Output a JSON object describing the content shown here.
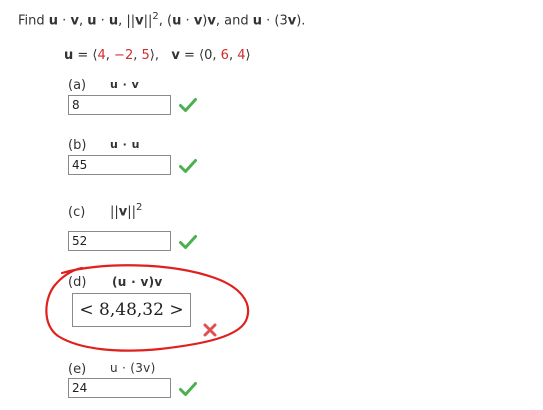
{
  "prompt": {
    "find": "Find",
    "u1": "u",
    "dot1": " · ",
    "v1": "v",
    "sep1": ",  ",
    "u2": "u",
    "dot2": " · ",
    "u3": "u",
    "sep2": ",  ",
    "norm_open": "||",
    "norm_v": "v",
    "norm_close": "||",
    "sq": "2",
    "sep3": ",  (",
    "uv_u": "u",
    "uv_dot": " · ",
    "uv_v": "v",
    "uv_close": ")",
    "uv_vec": "v",
    "sep4": ", and ",
    "u4": "u",
    "dot4": " · (3",
    "v4": "v",
    "end": ")."
  },
  "given": {
    "u_label": "u",
    "u_eq": " = ⟨",
    "u_a": "4",
    "u_c1": ", ",
    "u_b": "−2",
    "u_c2": ", ",
    "u_c": "5",
    "u_close": "⟩,",
    "v_label": "v",
    "v_eq": " = ⟨",
    "v_a": "0",
    "v_c1": ", ",
    "v_b": "6",
    "v_c2": ", ",
    "v_c": "4",
    "v_close": "⟩"
  },
  "parts": [
    {
      "letter": "(a)",
      "expr": "u · v",
      "value": "8",
      "status": "correct"
    },
    {
      "letter": "(b)",
      "expr": "u · u",
      "value": "45",
      "status": "correct"
    },
    {
      "letter": "(c)",
      "expr_open": "||",
      "expr_v": "v",
      "expr_close": "||",
      "sup": "2",
      "value": "52",
      "status": "correct"
    },
    {
      "letter": "(d)",
      "expr": "(u · v)v",
      "value": "< 8,48,32 >",
      "status": "incorrect"
    },
    {
      "letter": "(e)",
      "expr": "u · (3v)",
      "value": "24",
      "status": "correct"
    }
  ],
  "colors": {
    "check": "#4caf50",
    "cross": "#e05050",
    "annotation": "#e0201c",
    "red_value": "#d32b2b"
  },
  "icons": {
    "correct": "check-icon",
    "incorrect": "cross-icon"
  }
}
